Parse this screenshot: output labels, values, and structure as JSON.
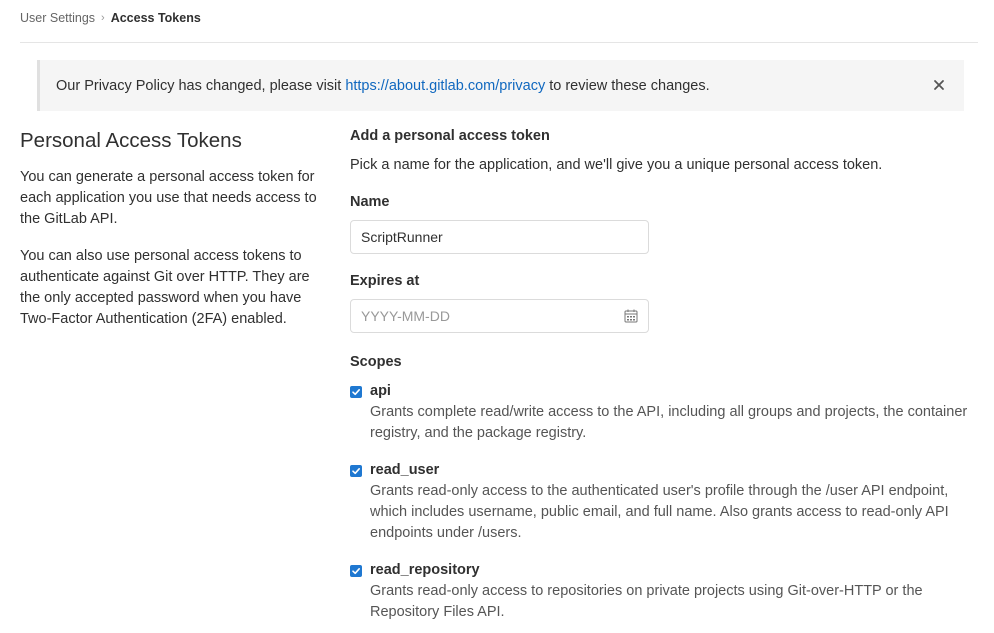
{
  "breadcrumb": {
    "parent": "User Settings",
    "separator": "›",
    "current": "Access Tokens"
  },
  "alert": {
    "text_before": "Our Privacy Policy has changed, please visit",
    "link": "https://about.gitlab.com/privacy",
    "text_after": "to review these changes.",
    "close_icon": "close-icon"
  },
  "left": {
    "title": "Personal Access Tokens",
    "paragraph1": "You can generate a personal access token for each application you use that needs access to the GitLab API.",
    "paragraph2": "You can also use personal access tokens to authenticate against Git over HTTP. They are the only accepted password when you have Two-Factor Authentication (2FA) enabled."
  },
  "form": {
    "heading": "Add a personal access token",
    "lead": "Pick a name for the application, and we'll give you a unique personal access token.",
    "name_label": "Name",
    "name_value": "ScriptRunner",
    "expires_label": "Expires at",
    "expires_placeholder": "YYYY-MM-DD",
    "scopes_label": "Scopes",
    "scopes": [
      {
        "name": "api",
        "checked": true,
        "description": "Grants complete read/write access to the API, including all groups and projects, the container registry, and the package registry."
      },
      {
        "name": "read_user",
        "checked": true,
        "description": "Grants read-only access to the authenticated user's profile through the /user API endpoint, which includes username, public email, and full name. Also grants access to read-only API endpoints under /users."
      },
      {
        "name": "read_repository",
        "checked": true,
        "description": "Grants read-only access to repositories on private projects using Git-over-HTTP or the Repository Files API."
      }
    ]
  },
  "colors": {
    "link": "#1068bf",
    "checkbox": "#1f78d1",
    "alert_bg": "#f5f5f5"
  }
}
